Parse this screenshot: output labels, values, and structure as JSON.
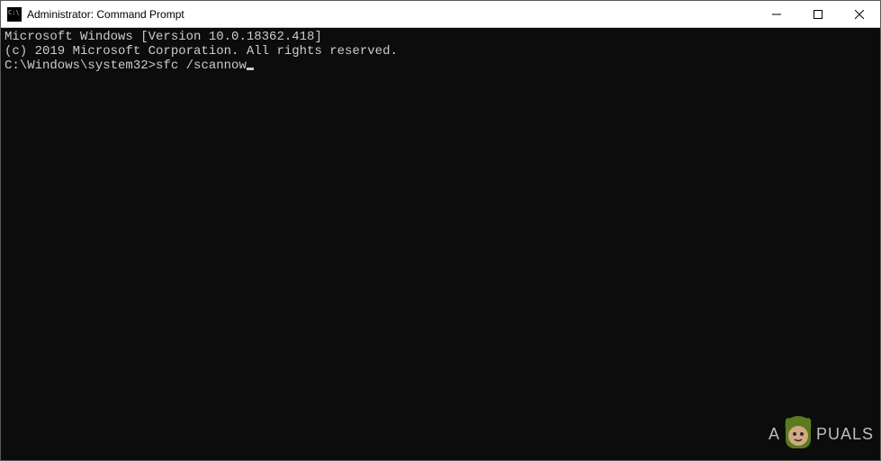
{
  "window": {
    "title": "Administrator: Command Prompt"
  },
  "terminal": {
    "line1": "Microsoft Windows [Version 10.0.18362.418]",
    "line2": "(c) 2019 Microsoft Corporation. All rights reserved.",
    "blank": "",
    "prompt": "C:\\Windows\\system32>",
    "command": "sfc /scannow"
  },
  "watermark": {
    "left": "A",
    "right": "PUALS"
  }
}
